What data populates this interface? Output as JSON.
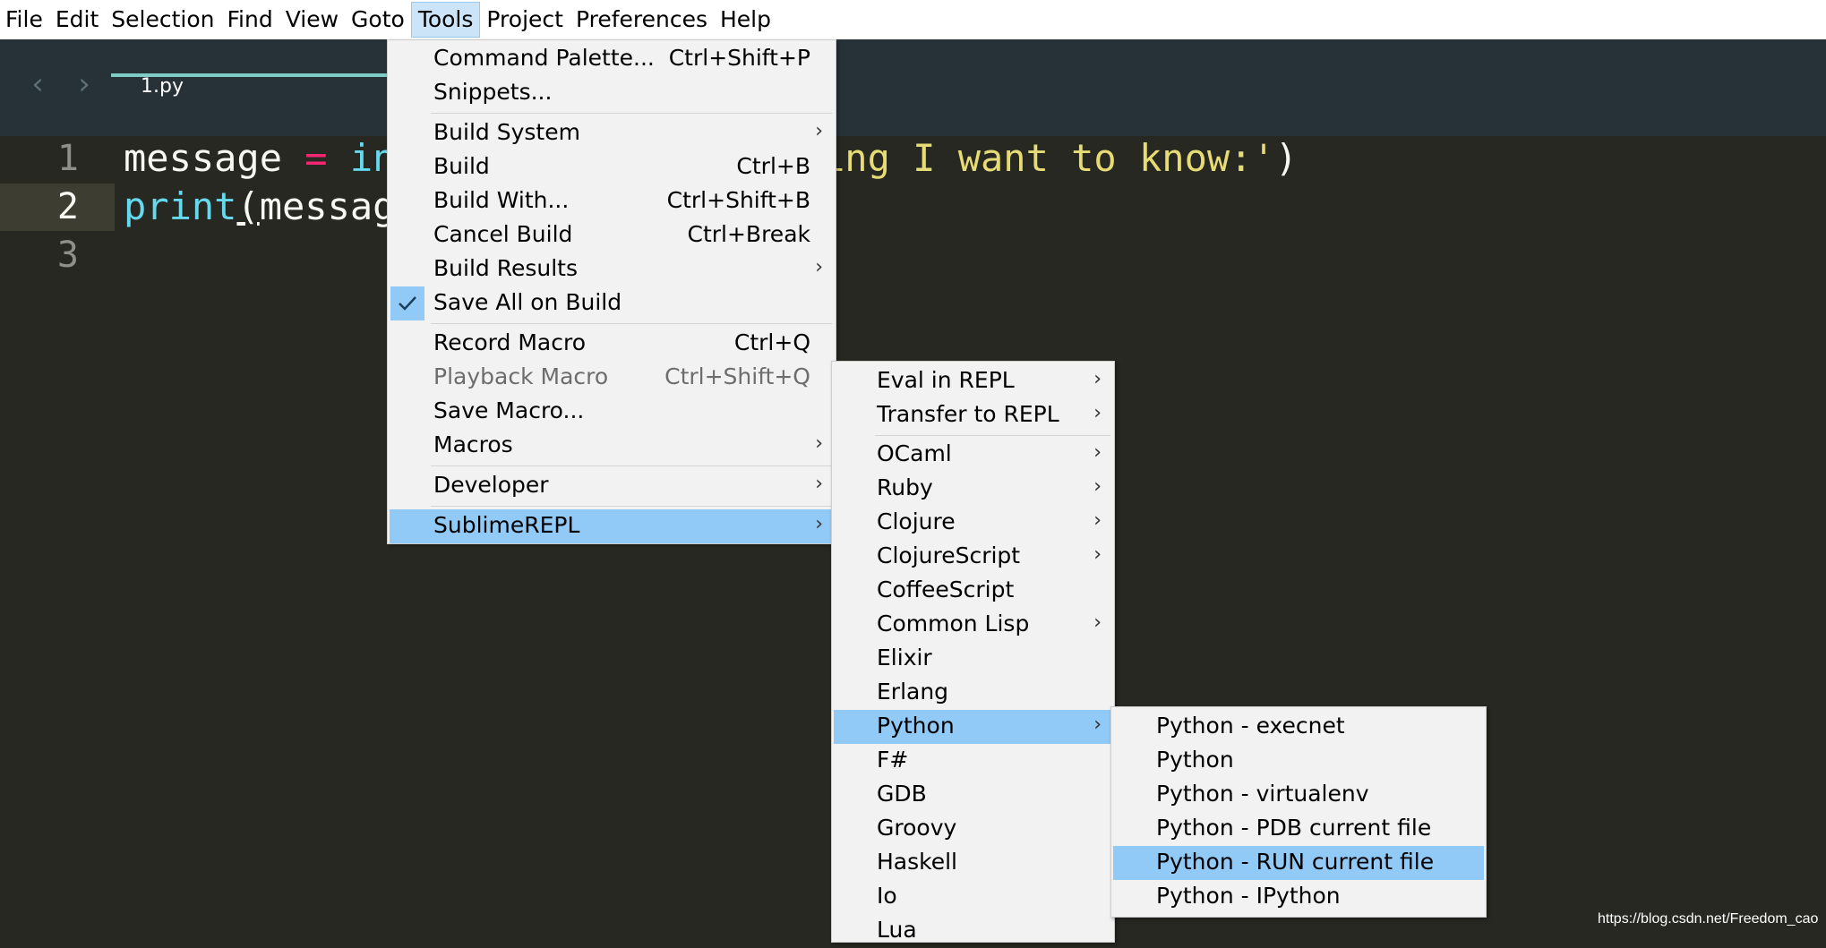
{
  "menubar": [
    "File",
    "Edit",
    "Selection",
    "Find",
    "View",
    "Goto",
    "Tools",
    "Project",
    "Preferences",
    "Help"
  ],
  "tab": {
    "label": "1.py"
  },
  "editor": {
    "line_numbers": [
      "1",
      "2",
      "3"
    ],
    "line1": {
      "var": "message ",
      "op": "=",
      "fn": " in",
      "str": "ing I want to know:'",
      "close": ")"
    },
    "line2": {
      "fn": "print",
      "paren": "(",
      "var": "messag"
    }
  },
  "tools_menu": [
    {
      "label": "Command Palette...",
      "shortcut": "Ctrl+Shift+P"
    },
    {
      "label": "Snippets..."
    },
    {
      "sep": true
    },
    {
      "label": "Build System",
      "submenu": true
    },
    {
      "label": "Build",
      "shortcut": "Ctrl+B"
    },
    {
      "label": "Build With...",
      "shortcut": "Ctrl+Shift+B"
    },
    {
      "label": "Cancel Build",
      "shortcut": "Ctrl+Break"
    },
    {
      "label": "Build Results",
      "submenu": true
    },
    {
      "label": "Save All on Build",
      "checked": true
    },
    {
      "sep": true
    },
    {
      "label": "Record Macro",
      "shortcut": "Ctrl+Q"
    },
    {
      "label": "Playback Macro",
      "shortcut": "Ctrl+Shift+Q",
      "disabled": true
    },
    {
      "label": "Save Macro..."
    },
    {
      "label": "Macros",
      "submenu": true
    },
    {
      "sep": true
    },
    {
      "label": "Developer",
      "submenu": true
    },
    {
      "sep": true
    },
    {
      "label": "SublimeREPL",
      "submenu": true,
      "highlighted": true
    }
  ],
  "repl_menu": [
    {
      "label": "Eval in REPL",
      "submenu": true
    },
    {
      "label": "Transfer to REPL",
      "submenu": true
    },
    {
      "sep": true
    },
    {
      "label": "OCaml",
      "submenu": true
    },
    {
      "label": "Ruby",
      "submenu": true
    },
    {
      "label": "Clojure",
      "submenu": true
    },
    {
      "label": "ClojureScript",
      "submenu": true
    },
    {
      "label": "CoffeeScript"
    },
    {
      "label": "Common Lisp",
      "submenu": true
    },
    {
      "label": "Elixir"
    },
    {
      "label": "Erlang"
    },
    {
      "label": "Python",
      "submenu": true,
      "highlighted": true
    },
    {
      "label": "F#"
    },
    {
      "label": "GDB"
    },
    {
      "label": "Groovy"
    },
    {
      "label": "Haskell"
    },
    {
      "label": "Io"
    },
    {
      "label": "Lua"
    }
  ],
  "python_menu": [
    {
      "label": "Python - execnet"
    },
    {
      "label": "Python"
    },
    {
      "label": "Python - virtualenv"
    },
    {
      "label": "Python - PDB current file"
    },
    {
      "label": "Python - RUN current file",
      "highlighted": true
    },
    {
      "label": "Python - IPython"
    }
  ],
  "watermark": "https://blog.csdn.net/Freedom_cao",
  "colors": {
    "menu_highlight": "#91c9f7",
    "editor_bg": "#272822",
    "tabbar_bg": "#263238",
    "tab_accent": "#80cbc4"
  }
}
